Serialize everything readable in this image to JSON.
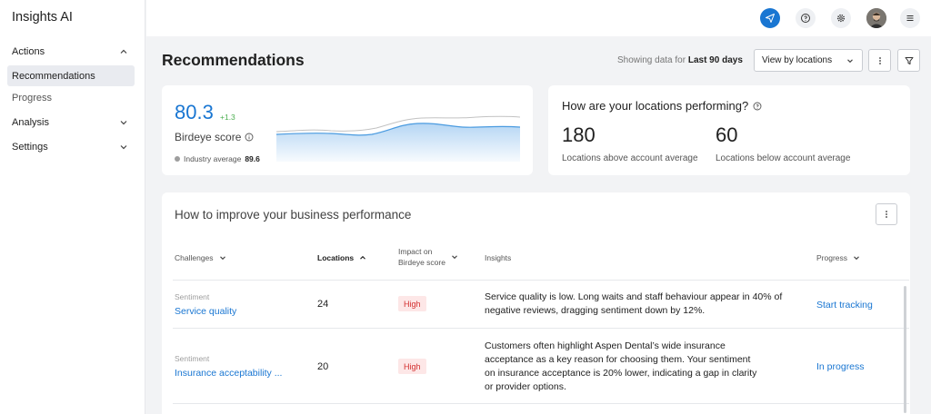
{
  "app": {
    "title": "Insights AI"
  },
  "sidebar": {
    "items": [
      {
        "label": "Actions",
        "type": "group",
        "expanded": true
      },
      {
        "label": "Recommendations",
        "type": "sub",
        "active": true
      },
      {
        "label": "Progress",
        "type": "sub"
      },
      {
        "label": "Analysis",
        "type": "group",
        "expanded": false
      },
      {
        "label": "Settings",
        "type": "group",
        "expanded": false
      }
    ]
  },
  "topbar": {
    "icons": [
      "send-icon",
      "help-icon",
      "gear-icon",
      "avatar",
      "menu-icon"
    ],
    "accent": "#1976d2"
  },
  "header": {
    "title": "Recommendations",
    "showing_prefix": "Showing data for",
    "showing_range": "Last 90 days",
    "view_select": "View by locations"
  },
  "score_card": {
    "value": "80.3",
    "delta": "+1.3",
    "label": "Birdeye score",
    "industry_label": "Industry average",
    "industry_value": "89.6"
  },
  "perf_card": {
    "title": "How are your locations performing?",
    "above_value": "180",
    "above_label": "Locations above account average",
    "below_value": "60",
    "below_label": "Locations below account average"
  },
  "table": {
    "title": "How to improve your business performance",
    "columns": {
      "challenges": "Challenges",
      "locations": "Locations",
      "impact_1": "Impact on",
      "impact_2": "Birdeye score",
      "insights": "Insights",
      "progress": "Progress"
    },
    "rows": [
      {
        "category": "Sentiment",
        "name": "Service quality",
        "locations": "24",
        "impact": "High",
        "insight": "Service quality is low. Long waits and staff behaviour appear in 40% of negative reviews, dragging sentiment down by 12%.",
        "progress": "Start tracking"
      },
      {
        "category": "Sentiment",
        "name": "Insurance acceptability ...",
        "locations": "20",
        "impact": "High",
        "insight": "Customers often highlight Aspen Dental’s wide insurance acceptance as a key reason for choosing them. Your sentiment on insurance acceptance is 20% lower, indicating a gap in clarity or provider options.",
        "progress": "In progress"
      }
    ]
  }
}
